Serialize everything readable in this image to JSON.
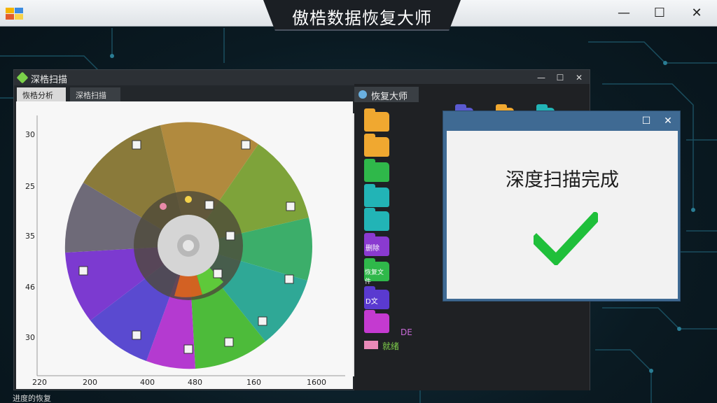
{
  "app": {
    "title": "傲梏数据恢复大师",
    "footer_label": "进度的恢复"
  },
  "scan_window": {
    "title": "深梏扫描",
    "tabs": [
      "恢梏分析",
      "深梏扫描"
    ],
    "y_ticks": [
      "30",
      "25",
      "35",
      "46",
      "30"
    ],
    "x_ticks": [
      "220",
      "200",
      "400",
      "480",
      "160",
      "1600"
    ]
  },
  "recover_panel": {
    "tab_label": "恢复大师",
    "folders": [
      {
        "color": "#f0a830",
        "label": ""
      },
      {
        "color": "#f0a830",
        "label": ""
      },
      {
        "color": "#2fb84a",
        "label": ""
      },
      {
        "color": "#22b4b6",
        "label": ""
      },
      {
        "color": "#22b4b6",
        "label": ""
      },
      {
        "color": "#8a3ad0",
        "label": "删除"
      },
      {
        "color": "#2fb84a",
        "label": "恢复文件"
      },
      {
        "color": "#5a3ad0",
        "label": "D文"
      },
      {
        "color": "#c43ad0",
        "label": ""
      }
    ],
    "side_label": "DE",
    "bottom_label": "就绪"
  },
  "dialog": {
    "message": "深度扫描完成",
    "check_color": "#1fbf3a"
  },
  "colors": {
    "accent": "#3f6a93",
    "title_bg": "#1b1f24"
  }
}
